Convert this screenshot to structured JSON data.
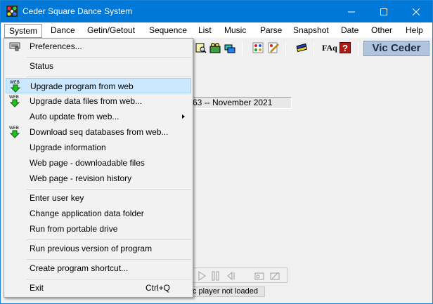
{
  "window": {
    "title": "Ceder Square Dance System",
    "controls": [
      "minimize",
      "maximize",
      "close"
    ]
  },
  "menubar": {
    "items": [
      {
        "label": "System",
        "active": true
      },
      {
        "label": "Dance"
      },
      {
        "label": "Getin/Getout"
      },
      {
        "label": "Sequence"
      },
      {
        "label": "List"
      },
      {
        "label": "Music"
      },
      {
        "label": "Parse"
      },
      {
        "label": "Snapshot"
      },
      {
        "label": "Date"
      },
      {
        "label": "Other"
      },
      {
        "label": "Help"
      }
    ]
  },
  "toolbar": {
    "icons": [
      "find-icon",
      "dancers-icon",
      "cards-icon",
      "grid-icon",
      "edit-icon",
      "books-icon",
      "faq-icon",
      "help-icon"
    ],
    "faq_label": "FAq",
    "help_label": "?",
    "user_name": "Vic Ceder"
  },
  "main": {
    "date_text": "63  --  November 2021",
    "player_status": "c player not loaded"
  },
  "system_menu": {
    "items": [
      {
        "label": "Preferences...",
        "icon": "preferences-icon"
      },
      {
        "label": "Status"
      },
      {
        "label": "Upgrade program from web",
        "icon": "web-download-icon",
        "highlighted": true
      },
      {
        "label": "Upgrade data files from web...",
        "icon": "web-download-icon"
      },
      {
        "label": "Auto update from web...",
        "submenu": true
      },
      {
        "label": "Download seq databases from web...",
        "icon": "web-download-icon"
      },
      {
        "label": "Upgrade information"
      },
      {
        "label": "Web page - downloadable files"
      },
      {
        "label": "Web page - revision history"
      },
      {
        "label": "Enter user key"
      },
      {
        "label": "Change application data folder"
      },
      {
        "label": "Run from portable drive"
      },
      {
        "label": "Run previous version of program"
      },
      {
        "label": "Create program shortcut..."
      },
      {
        "label": "Exit",
        "shortcut": "Ctrl+Q"
      }
    ],
    "icon_badge": "WEB"
  },
  "colors": {
    "titlebar": "#0078d7",
    "highlight": "#cce8ff",
    "user_badge": "#b0c4de"
  }
}
